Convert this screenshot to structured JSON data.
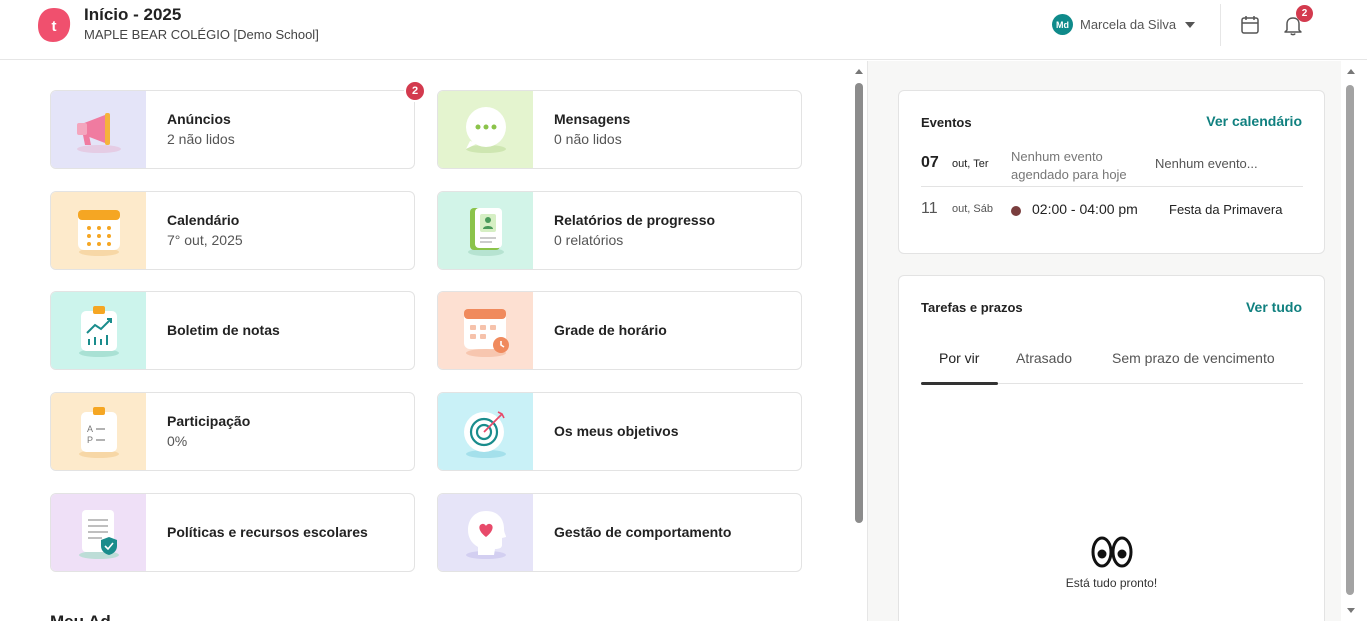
{
  "header": {
    "title": "Início - 2025",
    "school": "MAPLE BEAR COLÉGIO [Demo School]",
    "user_initials": "Md",
    "user_name": "Marcela da Silva",
    "notification_count": "2",
    "brand_color": "#f0506e",
    "accent_color": "#10807f"
  },
  "cards": [
    {
      "title": "Anúncios",
      "subtitle": "2 não lidos",
      "icon": "megaphone-icon",
      "badge": "2"
    },
    {
      "title": "Mensagens",
      "subtitle": "0 não lidos",
      "icon": "chat-bubble-icon"
    },
    {
      "title": "Calendário",
      "subtitle": "7° out, 2025",
      "icon": "calendar-icon"
    },
    {
      "title": "Relatórios de progresso",
      "subtitle": "0 relatórios",
      "icon": "report-book-icon"
    },
    {
      "title": "Boletim de notas",
      "icon": "clipboard-chart-icon"
    },
    {
      "title": "Grade de horário",
      "icon": "schedule-calendar-icon"
    },
    {
      "title": "Participação",
      "subtitle": "0%",
      "icon": "attendance-clipboard-icon"
    },
    {
      "title": "Os meus objetivos",
      "icon": "target-icon"
    },
    {
      "title": "Políticas e recursos escolares",
      "icon": "policy-document-icon"
    },
    {
      "title": "Gestão de comportamento",
      "icon": "heart-head-icon"
    }
  ],
  "section_peek": "Meu Ad",
  "events": {
    "title": "Eventos",
    "link": "Ver calendário",
    "rows": [
      {
        "day": "07",
        "month": "out, Ter",
        "none_today": "Nenhum evento agendado para hoje",
        "none_other": "Nenhum evento..."
      },
      {
        "day": "11",
        "month": "out, Sáb",
        "time": "02:00 - 04:00 pm",
        "name": "Festa da Primavera"
      }
    ]
  },
  "tasks": {
    "title": "Tarefas e prazos",
    "link": "Ver tudo",
    "tabs": [
      "Por vir",
      "Atrasado",
      "Sem prazo de vencimento"
    ],
    "active_tab": "Por vir",
    "empty_text": "Está tudo pronto!"
  }
}
